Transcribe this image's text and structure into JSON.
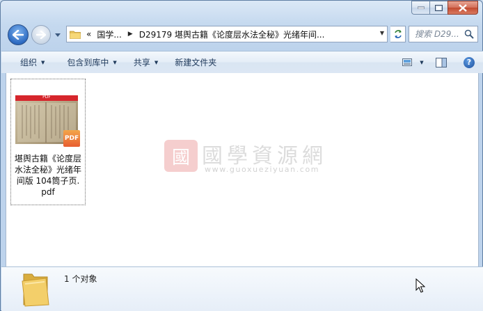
{
  "window": {
    "minimize_label": "—",
    "maximize_label": "□",
    "close_label": "✕"
  },
  "nav": {
    "back_icon": "back-arrow-icon",
    "forward_icon": "forward-arrow-icon",
    "address": {
      "overflow": "«",
      "crumbs": [
        "国学...",
        "D29179 堪舆古籍《论度层水法全秘》光绪年间..."
      ]
    },
    "search_placeholder": "搜索 D29..."
  },
  "commandbar": {
    "items": [
      {
        "label": "组织",
        "has_dropdown": true
      },
      {
        "label": "包含到库中",
        "has_dropdown": true
      },
      {
        "label": "共享",
        "has_dropdown": true
      },
      {
        "label": "新建文件夹",
        "has_dropdown": false
      }
    ],
    "right_icons": [
      "view-options-icon",
      "preview-pane-icon",
      "help-icon"
    ],
    "help_label": "?"
  },
  "files": [
    {
      "name": "堪舆古籍《论度层水法全秘》光绪年间版 104筒子页.pdf",
      "name_lines": [
        "堪舆古籍《论度层",
        "水法全秘》光绪年",
        "间版 104筒子页.",
        "pdf"
      ],
      "thumb_header": "PDF",
      "badge": "PDF"
    }
  ],
  "watermark": {
    "seal": "國",
    "text": "國學資源網",
    "url": "www.guoxueziyuan.com"
  },
  "details": {
    "count_text": "1 个对象"
  },
  "colors": {
    "accent": "#1e395b",
    "close_red": "#c24a30",
    "pdf_red": "#d6262c"
  }
}
